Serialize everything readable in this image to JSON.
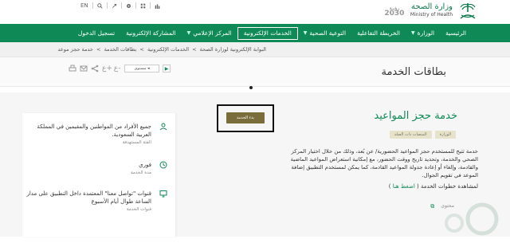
{
  "utility_bar": {
    "language": "EN",
    "icons": [
      "search-icon",
      "accessibility-icon",
      "settings-icon",
      "sitemap-icon",
      "stats-icon"
    ]
  },
  "logo": {
    "vision_top": "رؤيـة",
    "vision_year": "2030",
    "ministry_ar": "وزارة الصحة",
    "ministry_en": "Ministry of Health"
  },
  "nav": {
    "items": [
      {
        "label": "الرئيسية",
        "dropdown": false,
        "active": false
      },
      {
        "label": "الوزارة",
        "dropdown": true,
        "active": false
      },
      {
        "label": "الخريطة التفاعلية",
        "dropdown": false,
        "active": false
      },
      {
        "label": "التوعية الصحية",
        "dropdown": true,
        "active": false
      },
      {
        "label": "الخدمات الإلكترونية",
        "dropdown": false,
        "active": true
      },
      {
        "label": "المركز الإعلامي",
        "dropdown": true,
        "active": false
      },
      {
        "label": "المشاركة الإلكترونية",
        "dropdown": false,
        "active": false
      },
      {
        "label": "تسجيل الدخول",
        "dropdown": false,
        "active": false
      }
    ]
  },
  "breadcrumb": {
    "items": [
      "البوابة الإلكترونية لوزارة الصحة",
      "الخدمات الإلكترونية",
      "بطاقات الخدمة",
      "خدمة حجز موعد"
    ],
    "separator": ">"
  },
  "page": {
    "title": "بطاقات الخدمة"
  },
  "toolbar": {
    "volume_label": "مستوى"
  },
  "service": {
    "title": "خدمة حجز المواعيد",
    "tags": [
      "الوزارة",
      "المنصات ذات الصلة"
    ],
    "description": "خدمة تتيح للمستخدم حجز المواعيد الحضورية/ عن بُعد، وذلك من خلال اختيار المركز الصحي والخدمة، وتحديد تاريخ ووقت الحضور، مع إمكانية استعراض المواعيد الماضية والقادمة، وإلغاء أو إعادة جدولة المواعيد القادمة، كما يمكن لمستخدم التطبيق إضافة الموعد في تقويم الجوال.",
    "steps_prefix": "لمشاهدة خطوات الخدمة",
    "steps_link": "اضغط هنا",
    "start_button": "بدء الخدمة",
    "bottom_label": "محتوى"
  },
  "info_card": {
    "rows": [
      {
        "icon": "user-icon",
        "value": "جميع الأفراد من المواطنين والمقيمين في المملكة العربية السعودية.",
        "label": "الفئة المستهدفة"
      },
      {
        "icon": "clock-icon",
        "value": "فوري",
        "label": "مدة الخدمة"
      },
      {
        "icon": "monitor-icon",
        "value": "قنوات \"تواصل معنا\" المعتمدة داخل التطبيق على مدار الساعة طوال أيام الأسبوع",
        "label": "قنوات الخدمة"
      }
    ]
  },
  "colors": {
    "brand_green": "#0f8a56",
    "start_button": "#7a6d3c",
    "tag_bg": "#e7e3ca"
  }
}
